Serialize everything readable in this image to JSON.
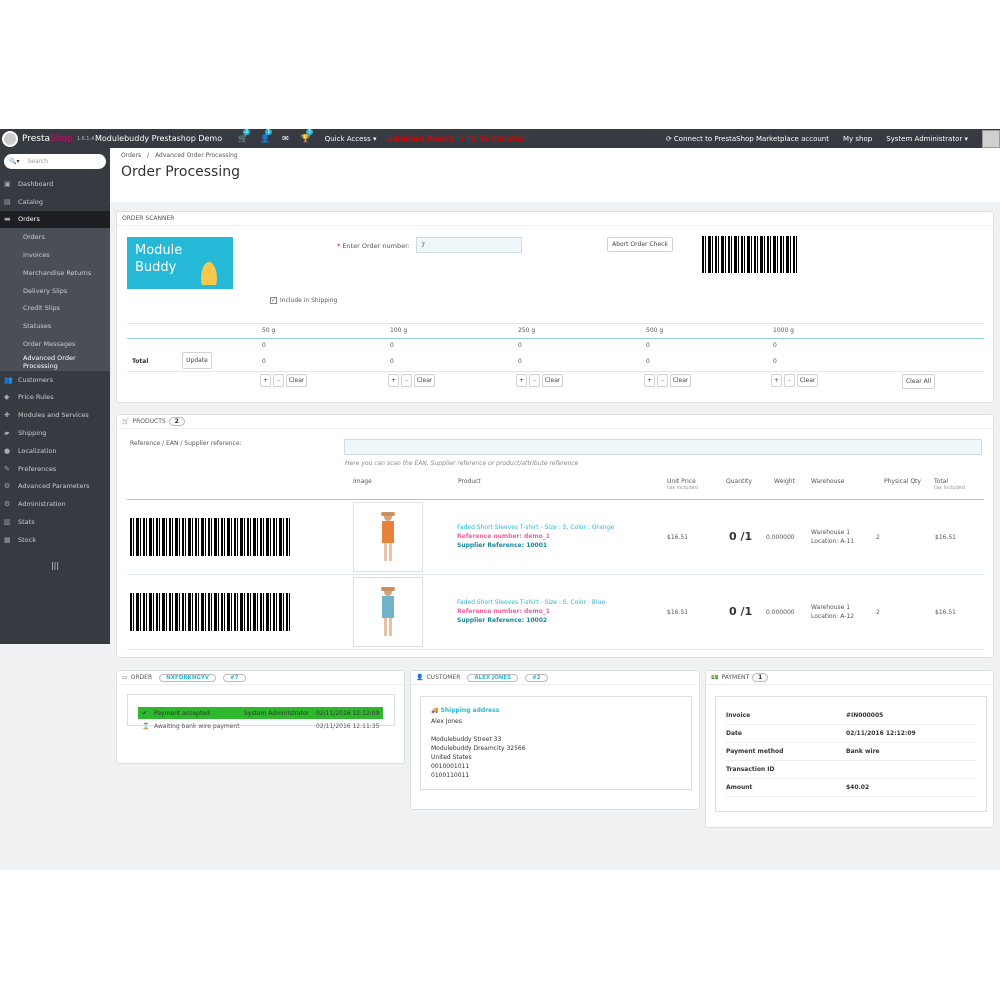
{
  "topbar": {
    "brand_a": "Presta",
    "brand_b": "Shop",
    "version": "1.6.1.4",
    "shop_name": "Modulebuddy Prestashop Demo",
    "cart_count": "2",
    "user_count": "1",
    "trophy_count": "3",
    "quick_access": "Quick Access",
    "db_reset": "Database Resets in 40:49 minutes!",
    "marketplace": "Connect to PrestaShop Marketplace account",
    "my_shop": "My shop",
    "admin": "System Administrator"
  },
  "sidebar": {
    "search_placeholder": "Search",
    "items": [
      {
        "label": "Dashboard",
        "icon": "dashboard-icon"
      },
      {
        "label": "Catalog",
        "icon": "catalog-icon"
      },
      {
        "label": "Orders",
        "icon": "orders-icon"
      },
      {
        "label": "Customers",
        "icon": "customers-icon"
      },
      {
        "label": "Price Rules",
        "icon": "price-rules-icon"
      },
      {
        "label": "Modules and Services",
        "icon": "modules-icon"
      },
      {
        "label": "Shipping",
        "icon": "shipping-icon"
      },
      {
        "label": "Localization",
        "icon": "localization-icon"
      },
      {
        "label": "Preferences",
        "icon": "preferences-icon"
      },
      {
        "label": "Advanced Parameters",
        "icon": "advanced-icon"
      },
      {
        "label": "Administration",
        "icon": "administration-icon"
      },
      {
        "label": "Stats",
        "icon": "stats-icon"
      },
      {
        "label": "Stock",
        "icon": "stock-icon"
      }
    ],
    "orders_sub": [
      "Orders",
      "Invoices",
      "Merchandise Returns",
      "Delivery Slips",
      "Credit Slips",
      "Statuses",
      "Order Messages",
      "Advanced Order Processing"
    ]
  },
  "header": {
    "breadcrumb_1": "Orders",
    "breadcrumb_sep": "/",
    "breadcrumb_2": "Advanced Order Processing",
    "title": "Order Processing"
  },
  "scanner": {
    "title": "ORDER SCANNER",
    "logo_line1": "Module",
    "logo_line2": "Buddy",
    "order_label": "Enter Order number:",
    "order_value": "7",
    "abort_btn": "Abort Order Check",
    "include_shipping": "Include in Shipping",
    "weights": [
      "50 g",
      "100 g",
      "250 g",
      "500 g",
      "1000 g"
    ],
    "row1": [
      "0",
      "0",
      "0",
      "0",
      "0"
    ],
    "total_label": "Total",
    "update_btn": "Update",
    "row2": [
      "0",
      "0",
      "0",
      "0",
      "0"
    ],
    "plus": "+",
    "minus": "-",
    "clear": "Clear",
    "clear_all": "Clear All"
  },
  "products": {
    "title": "PRODUCTS",
    "count": "2",
    "ref_label": "Reference / EAN / Supplier reference:",
    "ref_hint": "Here you can scan the EAN, Supplier reference or product/attribute reference",
    "cols": {
      "image": "Image",
      "product": "Product",
      "unit_price": "Unit Price",
      "unit_price_sub": "tax included",
      "quantity": "Quantity",
      "weight": "Weight",
      "warehouse": "Warehouse",
      "physical": "Physical Qty",
      "total": "Total",
      "total_sub": "tax included"
    },
    "rows": [
      {
        "name": "Faded Short Sleeves T-shirt - Size : S, Color : Orange",
        "ref": "Reference number: demo_1",
        "supplier": "Supplier Reference: 10001",
        "price": "$16.51",
        "qty": "0 /1",
        "weight": "0.000000",
        "warehouse": "Warehouse 1",
        "location": "Location: A-11",
        "physical": "2",
        "total": "$16.51",
        "shirt": "#e8823a"
      },
      {
        "name": "Faded Short Sleeves T-shirt - Size : S, Color : Blue",
        "ref": "Reference number: demo_1",
        "supplier": "Supplier Reference: 10002",
        "price": "$16.51",
        "qty": "0 /1",
        "weight": "0.000000",
        "warehouse": "Warehouse 1",
        "location": "Location: A-12",
        "physical": "2",
        "total": "$16.51",
        "shirt": "#6fb3c9"
      }
    ]
  },
  "order": {
    "title": "ORDER",
    "ref": "NXFDRKNGYV",
    "id": "#7",
    "statuses": [
      {
        "label": "Payment accepted",
        "by": "System Administrator",
        "date": "02/11/2016 12:12:09"
      },
      {
        "label": "Awaiting bank wire payment",
        "by": "",
        "date": "02/11/2016 12:11:35"
      }
    ]
  },
  "customer": {
    "title": "CUSTOMER",
    "name_badge": "ALEX JONES",
    "id": "#2",
    "shipping_title": "Shipping address",
    "lines": [
      "Alex Jones",
      "",
      "Modulebuddy Street 33",
      "Modulebuddy Dreamcity 32566",
      "United States",
      "0010001011",
      "0100110011"
    ]
  },
  "payment": {
    "title": "PAYMENT",
    "count": "1",
    "rows": [
      {
        "k": "Invoice",
        "v": "#IN000005"
      },
      {
        "k": "Date",
        "v": "02/11/2016 12:12:09"
      },
      {
        "k": "Payment method",
        "v": "Bank wire"
      },
      {
        "k": "Transaction ID",
        "v": ""
      },
      {
        "k": "Amount",
        "v": "$40.02"
      }
    ]
  },
  "colors": {
    "accent": "#25b9d7",
    "sidebar": "#363a41",
    "success": "#2eb82e",
    "error": "#e00000"
  }
}
